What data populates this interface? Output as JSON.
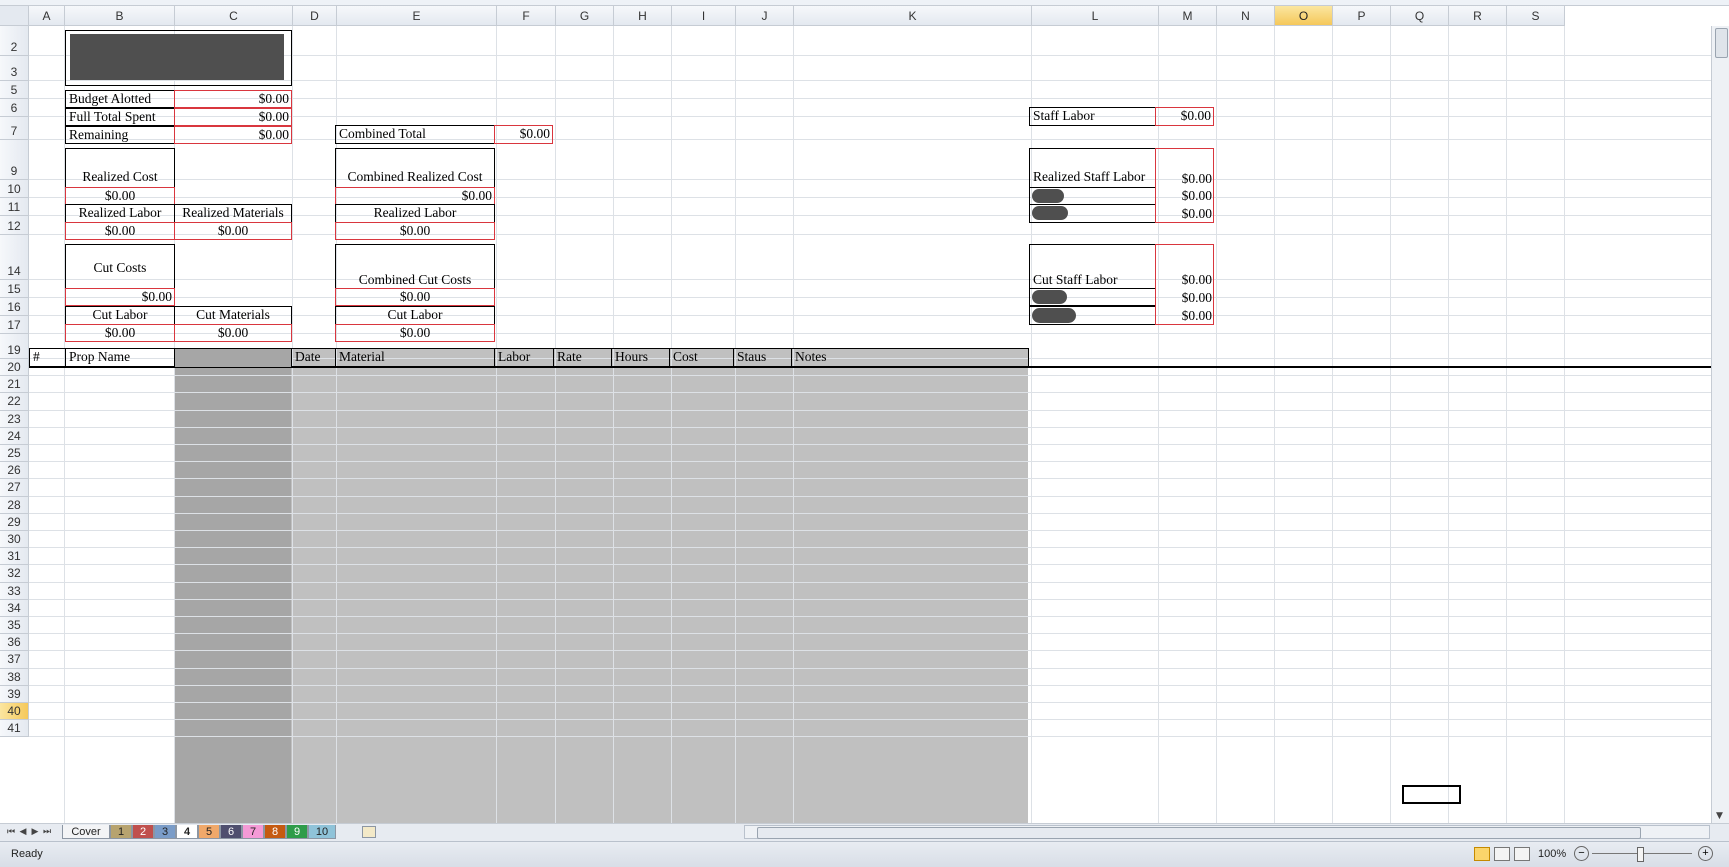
{
  "columns": [
    "A",
    "B",
    "C",
    "D",
    "E",
    "F",
    "G",
    "H",
    "I",
    "J",
    "K",
    "L",
    "M",
    "N",
    "O",
    "P",
    "Q",
    "R",
    "S"
  ],
  "selected_column": "O",
  "rows": [
    "2",
    "3",
    "5",
    "6",
    "7",
    "9",
    "10",
    "11",
    "12",
    "14",
    "15",
    "16",
    "17",
    "19",
    "20",
    "21",
    "22",
    "23",
    "24",
    "25",
    "26",
    "27",
    "28",
    "29",
    "30",
    "31",
    "32",
    "33",
    "34",
    "35",
    "36",
    "37",
    "38",
    "39",
    "40",
    "41"
  ],
  "selected_row": "40",
  "budget": {
    "allotted_label": "Budget Alotted",
    "allotted_value": "$0.00",
    "spent_label": "Full Total Spent",
    "spent_value": "$0.00",
    "remaining_label": "Remaining",
    "remaining_value": "$0.00"
  },
  "combined_total": {
    "label": "Combined Total",
    "value": "$0.00"
  },
  "staff_labor": {
    "label": "Staff Labor",
    "value": "$0.00"
  },
  "realized": {
    "cost_label": "Realized Cost",
    "cost_value": "$0.00",
    "labor_label": "Realized Labor",
    "labor_value": "$0.00",
    "materials_label": "Realized Materials",
    "materials_value": "$0.00"
  },
  "combined_realized": {
    "cost_label": "Combined Realized  Cost",
    "cost_value": "$0.00",
    "labor_label": "Realized Labor",
    "labor_value": "$0.00"
  },
  "realized_staff": {
    "label": "Realized Staff Labor",
    "values": [
      "$0.00",
      "$0.00",
      "$0.00"
    ]
  },
  "cut": {
    "costs_label": "Cut Costs",
    "costs_value": "$0.00",
    "labor_label": "Cut Labor",
    "labor_value": "$0.00",
    "materials_label": "Cut Materials",
    "materials_value": "$0.00"
  },
  "combined_cut": {
    "costs_label": "Combined Cut Costs",
    "costs_value": "$0.00",
    "labor_label": "Cut Labor",
    "labor_value": "$0.00"
  },
  "cut_staff": {
    "label": "Cut Staff Labor",
    "values": [
      "$0.00",
      "$0.00",
      "$0.00"
    ]
  },
  "table_headers": {
    "num": "#",
    "prop_name": "Prop Name",
    "date": "Date",
    "material": "Material",
    "labor": "Labor",
    "rate": "Rate",
    "hours": "Hours",
    "cost": "Cost",
    "status": "Staus",
    "notes": "Notes"
  },
  "sheet_tabs": [
    "Cover",
    "1",
    "2",
    "3",
    "4",
    "5",
    "6",
    "7",
    "8",
    "9",
    "10"
  ],
  "active_tab": "4",
  "status": {
    "ready": "Ready",
    "zoom": "100%"
  },
  "colors": {
    "header_bg": "#e4e9f0",
    "selected_header": "#f5c85a",
    "gray_fill": "#c0c0c0",
    "dark_fill": "#a6a6a6",
    "red_border": "#d9363e"
  }
}
